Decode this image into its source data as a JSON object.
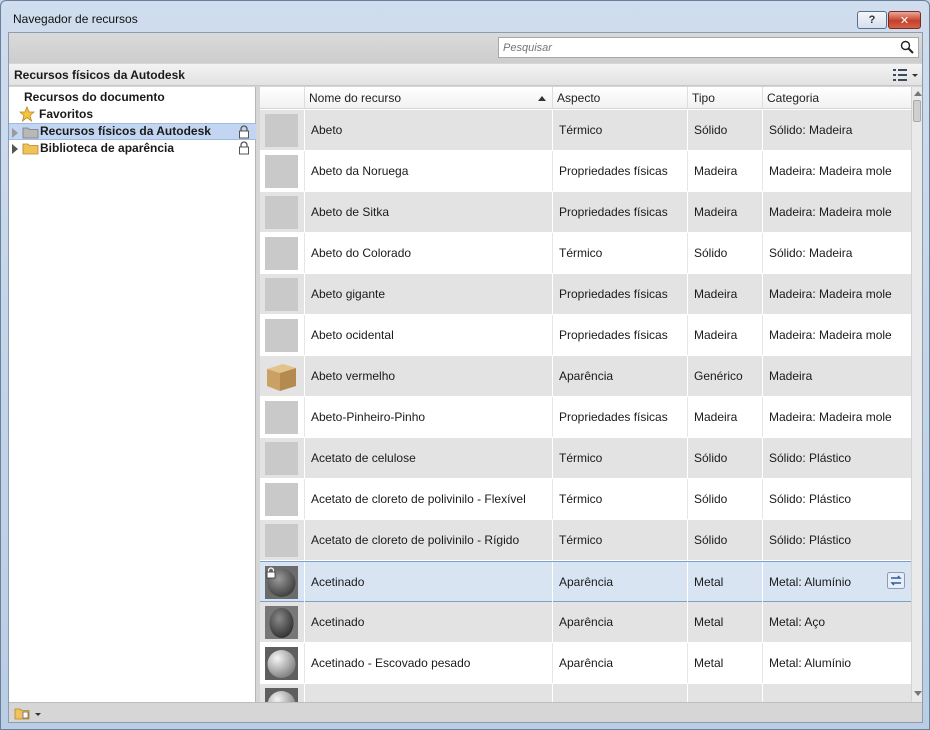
{
  "window": {
    "title": "Navegador de recursos",
    "help_label": "?",
    "close_label": "✕"
  },
  "search": {
    "placeholder": "Pesquisar"
  },
  "library_header": {
    "title": "Recursos físicos da Autodesk"
  },
  "tree": {
    "document_resources": "Recursos do documento",
    "favorites": "Favoritos",
    "items": [
      {
        "label": "Recursos físicos da Autodesk",
        "locked": true,
        "selected": true
      },
      {
        "label": "Biblioteca de aparência",
        "locked": true,
        "selected": false
      }
    ]
  },
  "columns": {
    "name": "Nome do recurso",
    "aspect": "Aspecto",
    "type": "Tipo",
    "category": "Categoria"
  },
  "rows": [
    {
      "name": "Abeto",
      "aspect": "Térmico",
      "type": "Sólido",
      "category": "Sólido: Madeira",
      "thumb": "blank"
    },
    {
      "name": "Abeto da Noruega",
      "aspect": "Propriedades físicas",
      "type": "Madeira",
      "category": "Madeira: Madeira mole",
      "thumb": "blank"
    },
    {
      "name": "Abeto de Sitka",
      "aspect": "Propriedades físicas",
      "type": "Madeira",
      "category": "Madeira: Madeira mole",
      "thumb": "blank"
    },
    {
      "name": "Abeto do Colorado",
      "aspect": "Térmico",
      "type": "Sólido",
      "category": "Sólido: Madeira",
      "thumb": "blank"
    },
    {
      "name": "Abeto gigante",
      "aspect": "Propriedades físicas",
      "type": "Madeira",
      "category": "Madeira: Madeira mole",
      "thumb": "blank"
    },
    {
      "name": "Abeto ocidental",
      "aspect": "Propriedades físicas",
      "type": "Madeira",
      "category": "Madeira: Madeira mole",
      "thumb": "blank"
    },
    {
      "name": "Abeto vermelho",
      "aspect": "Aparência",
      "type": "Genérico",
      "category": "Madeira",
      "thumb": "wood-cube"
    },
    {
      "name": "Abeto-Pinheiro-Pinho",
      "aspect": "Propriedades físicas",
      "type": "Madeira",
      "category": "Madeira: Madeira mole",
      "thumb": "blank"
    },
    {
      "name": "Acetato de celulose",
      "aspect": "Térmico",
      "type": "Sólido",
      "category": "Sólido: Plástico",
      "thumb": "blank"
    },
    {
      "name": "Acetato de cloreto de polivinilo - Flexível",
      "aspect": "Térmico",
      "type": "Sólido",
      "category": "Sólido: Plástico",
      "thumb": "blank"
    },
    {
      "name": "Acetato de cloreto de polivinilo - Rígido",
      "aspect": "Térmico",
      "type": "Sólido",
      "category": "Sólido: Plástico",
      "thumb": "blank"
    },
    {
      "name": "Acetinado",
      "aspect": "Aparência",
      "type": "Metal",
      "category": "Metal: Alumínio",
      "thumb": "dark-sphere",
      "selected": true
    },
    {
      "name": "Acetinado",
      "aspect": "Aparência",
      "type": "Metal",
      "category": "Metal: Aço",
      "thumb": "dark-egg"
    },
    {
      "name": "Acetinado - Escovado pesado",
      "aspect": "Aparência",
      "type": "Metal",
      "category": "Metal: Alumínio",
      "thumb": "light-sphere"
    },
    {
      "name": "",
      "aspect": "",
      "type": "",
      "category": "",
      "thumb": "light-sphere"
    }
  ],
  "colors": {
    "selection": "#c2d6f1",
    "row_alt": "#e3e3e3",
    "close_button": "#c5402a"
  },
  "icons": {
    "search": "magnifier-icon",
    "lock": "padlock-icon",
    "folder": "folder-icon",
    "favorites": "star-icon",
    "view": "list-view-icon",
    "replace": "swap-arrows-icon"
  }
}
